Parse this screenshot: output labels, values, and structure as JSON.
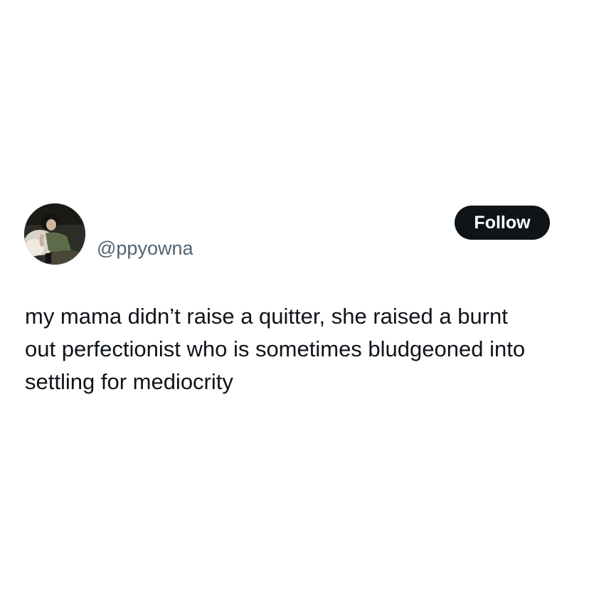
{
  "user": {
    "handle": "@ppyowna"
  },
  "follow_button": {
    "label": "Follow"
  },
  "tweet": {
    "lines": [
      "my mama didn’t raise a quitter, she raised a burnt",
      "out perfectionist who is sometimes bludgeoned into",
      "settling for mediocrity"
    ]
  },
  "colors": {
    "background": "#ffffff",
    "text_primary": "#0f1419",
    "text_secondary": "#536471",
    "button_bg": "#0f1419",
    "button_text": "#ffffff"
  },
  "icons": {
    "avatar": "profile-photo"
  }
}
